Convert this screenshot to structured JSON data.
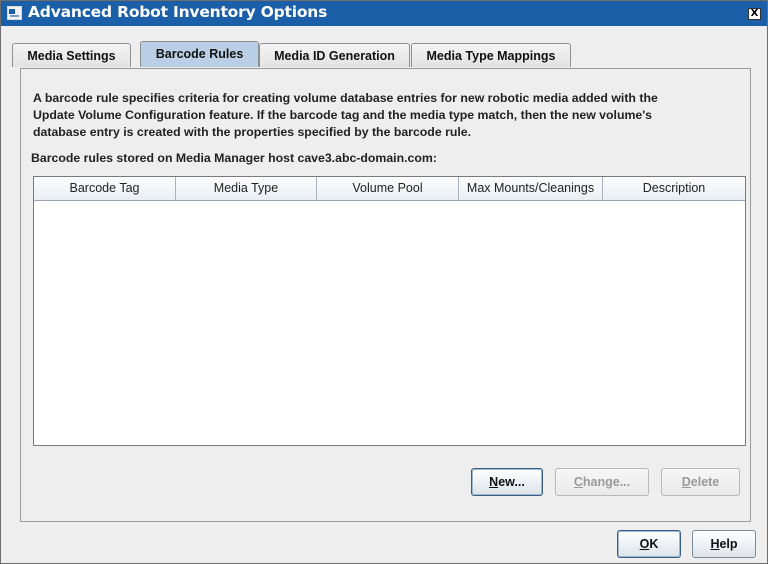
{
  "window": {
    "title": "Advanced Robot Inventory Options",
    "close_glyph": "X",
    "icon": "app-window-icon"
  },
  "tabs": [
    {
      "label": "Media Settings",
      "active": false
    },
    {
      "label": "Barcode Rules",
      "active": true
    },
    {
      "label": "Media ID Generation",
      "active": false
    },
    {
      "label": "Media Type Mappings",
      "active": false
    }
  ],
  "description": [
    "A barcode rule specifies criteria for creating volume database entries for new robotic media added with the",
    "Update Volume Configuration feature.  If the barcode tag and the media type match, then the new volume's",
    "database entry is created with the properties specified by the barcode rule."
  ],
  "host_label": "Barcode rules stored on Media Manager host cave3.abc-domain.com:",
  "table": {
    "columns": [
      "Barcode Tag",
      "Media Type",
      "Volume Pool",
      "Max Mounts/Cleanings",
      "Description"
    ],
    "rows": []
  },
  "buttons": {
    "new": {
      "mnemonic": "N",
      "rest": "ew...",
      "enabled": true
    },
    "change": {
      "mnemonic": "C",
      "rest": "hange...",
      "enabled": false
    },
    "delete": {
      "mnemonic": "D",
      "rest": "elete",
      "enabled": false
    },
    "ok": {
      "mnemonic": "O",
      "rest": "K",
      "enabled": true
    },
    "help": {
      "mnemonic": "H",
      "rest": "elp",
      "enabled": true
    }
  },
  "colors": {
    "titlebar": "#1a5fa8",
    "active_tab": "#b9cfe5",
    "window_bg": "#eeeeee"
  }
}
